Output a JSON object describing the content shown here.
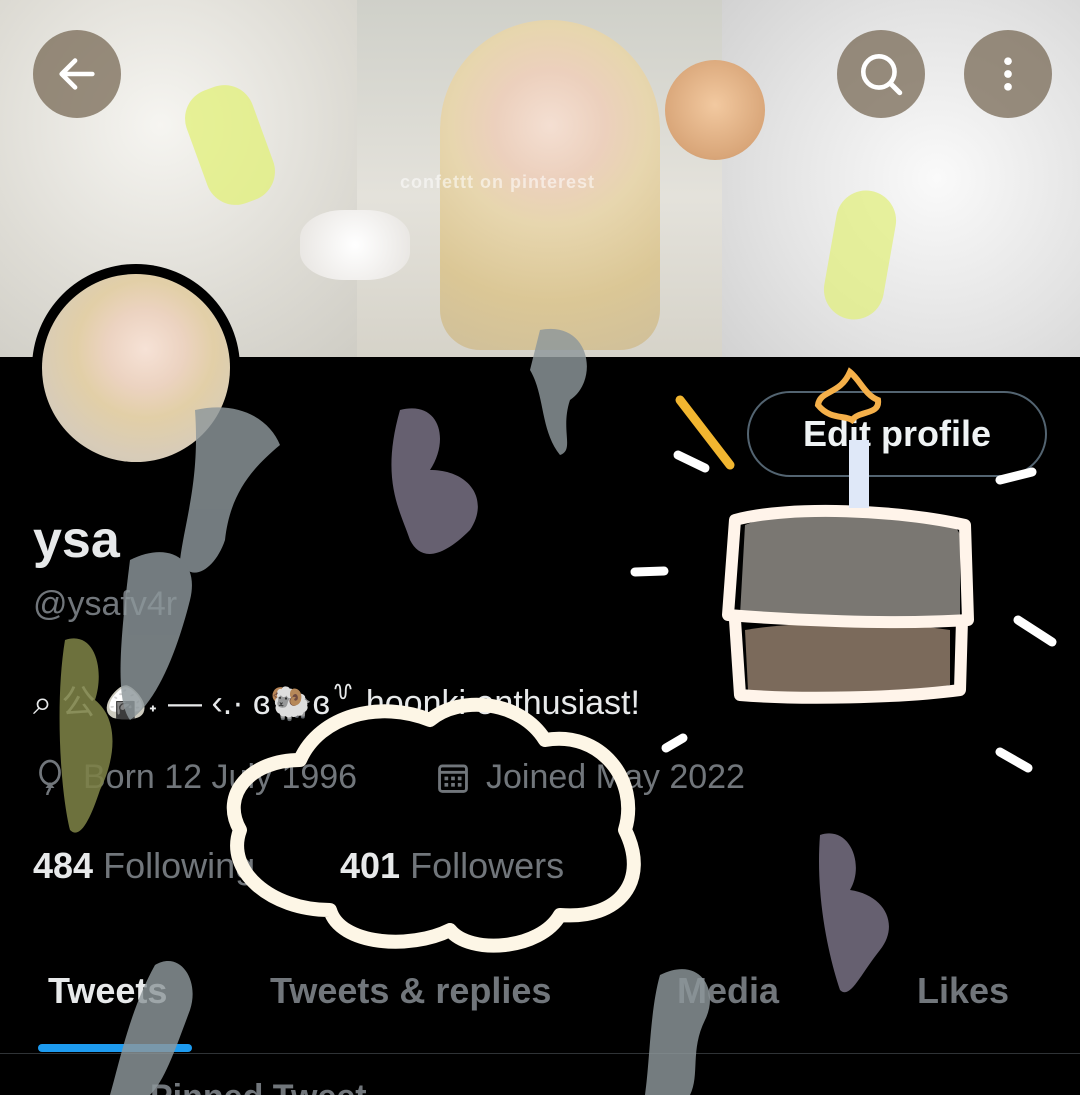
{
  "header": {
    "back_icon": "arrow-left-icon",
    "search_icon": "search-icon",
    "more_icon": "more-vertical-icon"
  },
  "profile": {
    "name": "ysa",
    "handle": "@ysafv4r",
    "bio": "⌕ 公 🍙˖ — ‹.· ɞ🐏ɞ꒷ hoonki enthusiast!",
    "born": "Born 12 July 1996",
    "joined": "Joined May 2022",
    "following_count": "484",
    "following_label": "Following",
    "followers_count": "401",
    "followers_label": "Followers",
    "edit_label": "Edit profile"
  },
  "banner": {
    "watermark": "confettt on pinterest"
  },
  "tabs": [
    {
      "label": "Tweets",
      "active": true
    },
    {
      "label": "Tweets & replies",
      "active": false
    },
    {
      "label": "Media",
      "active": false
    },
    {
      "label": "Likes",
      "active": false
    }
  ],
  "pinned_label": "Pinned Tweet",
  "colors": {
    "accent": "#1d9bf0",
    "background": "#000000",
    "secondary_text": "#71767b"
  }
}
